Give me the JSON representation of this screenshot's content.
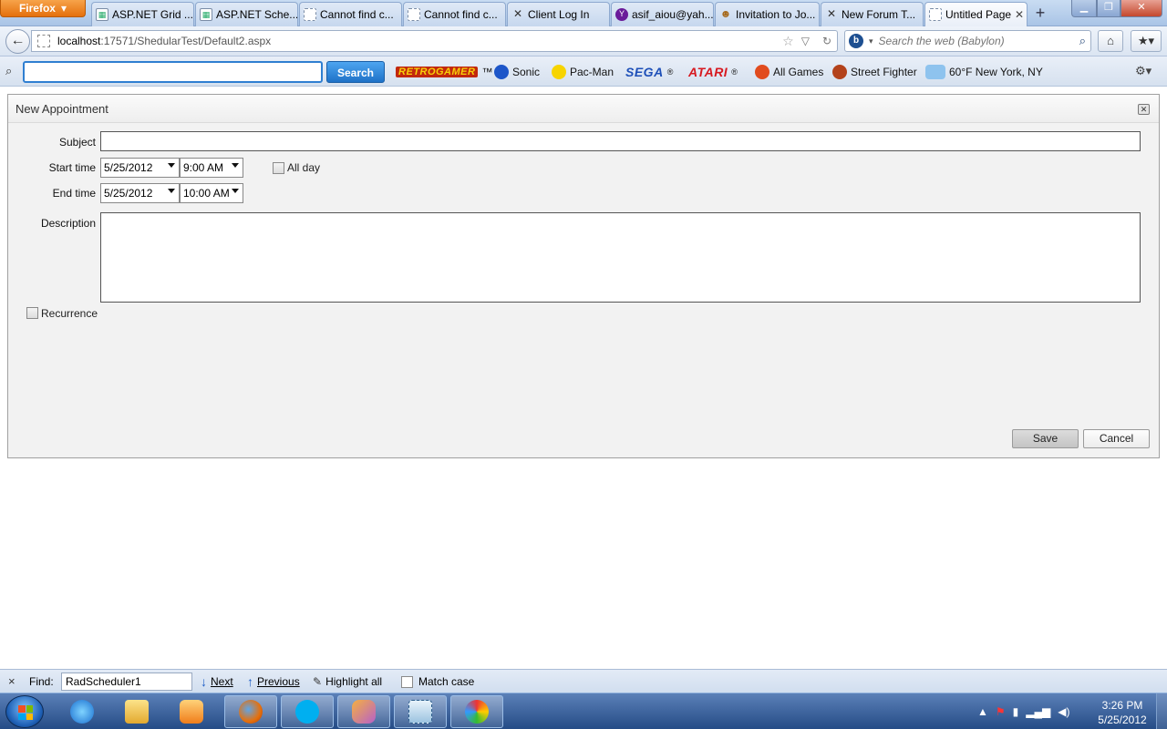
{
  "browser": {
    "menu_label": "Firefox",
    "tabs": [
      {
        "label": "ASP.NET Grid ...",
        "icon": "aspnet-icon"
      },
      {
        "label": "ASP.NET Sche...",
        "icon": "aspnet-icon"
      },
      {
        "label": "Cannot find c...",
        "icon": "blank-page-icon"
      },
      {
        "label": "Cannot find c...",
        "icon": "blank-page-icon"
      },
      {
        "label": "Client Log In",
        "icon": "xmarks-icon"
      },
      {
        "label": "asif_aiou@yah...",
        "icon": "yahoo-icon"
      },
      {
        "label": "Invitation to Jo...",
        "icon": "people-icon"
      },
      {
        "label": "New Forum T...",
        "icon": "xmarks-icon"
      },
      {
        "label": "Untitled Page",
        "icon": "blank-page-icon",
        "active": true
      }
    ],
    "url_host": "localhost",
    "url_rest": ":17571/ShedularTest/Default2.aspx",
    "search_placeholder": "Search the web (Babylon)"
  },
  "toolbar": {
    "search_button": "Search",
    "items": {
      "retrogamer": "RETROGAMER",
      "tm": "™",
      "sonic": "Sonic",
      "pacman": "Pac-Man",
      "sega": "SEGA",
      "atari": "ATARI",
      "reg": "®",
      "all_games": "All Games",
      "street_fighter": "Street Fighter",
      "weather": "60°F New York, NY"
    }
  },
  "appointment": {
    "title": "New Appointment",
    "subject_label": "Subject",
    "subject_value": "",
    "start_label": "Start time",
    "start_date": "5/25/2012",
    "start_time": "9:00 AM",
    "all_day_label": "All day",
    "all_day_checked": false,
    "end_label": "End time",
    "end_date": "5/25/2012",
    "end_time": "10:00 AM",
    "description_label": "Description",
    "description_value": "",
    "recurrence_label": "Recurrence",
    "recurrence_checked": false,
    "save_label": "Save",
    "cancel_label": "Cancel"
  },
  "findbar": {
    "close": "×",
    "label": "Find:",
    "value": "RadScheduler1",
    "next_label": "Next",
    "previous_label": "Previous",
    "highlight_label": "Highlight all",
    "match_case_label": "Match case"
  },
  "taskbar": {
    "apps": [
      "internet-explorer-icon",
      "windows-explorer-icon",
      "media-player-icon",
      "firefox-icon",
      "skype-icon",
      "visual-studio-icon",
      "snipping-tool-icon",
      "paint-icon"
    ],
    "clock_time": "3:26 PM",
    "clock_date": "5/25/2012"
  },
  "colors": {
    "firefox_orange": "#e5700c",
    "search_blue": "#1e72c8",
    "taskbar_blue": "#254c86"
  }
}
